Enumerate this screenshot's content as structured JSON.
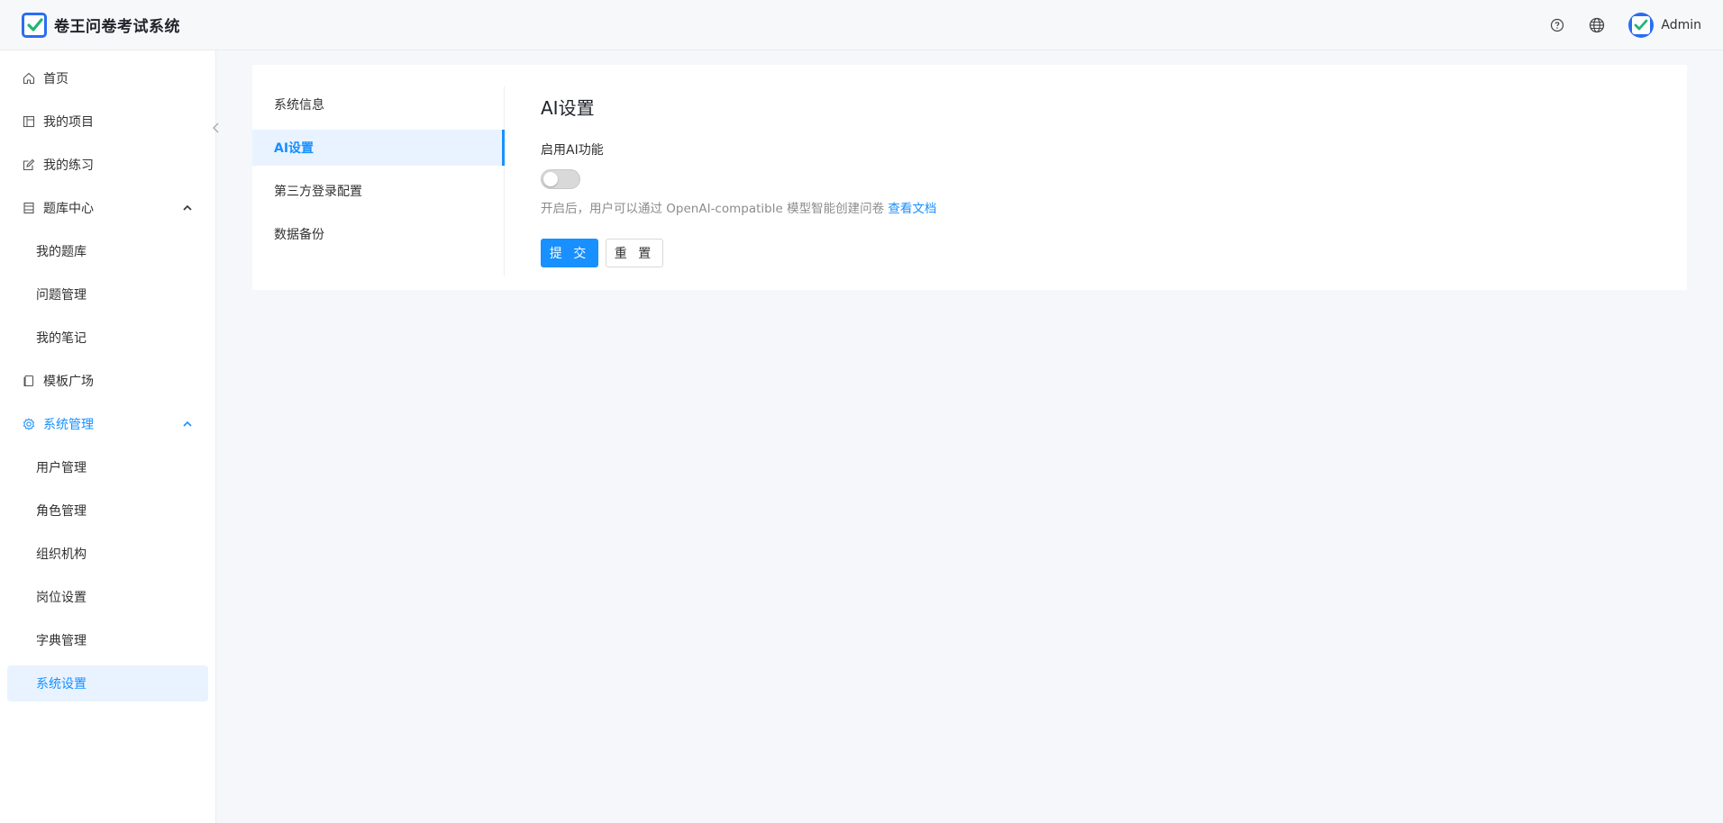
{
  "header": {
    "app_title": "卷王问卷考试系统",
    "user_name": "Admin",
    "icons": [
      "help-icon",
      "globe-icon",
      "avatar"
    ]
  },
  "sidebar": {
    "items": [
      {
        "label": "首页",
        "icon": "home-icon"
      },
      {
        "label": "我的项目",
        "icon": "project-icon"
      },
      {
        "label": "我的练习",
        "icon": "edit-icon"
      },
      {
        "label": "题库中心",
        "icon": "database-icon",
        "expanded": true
      },
      {
        "label": "我的题库"
      },
      {
        "label": "问题管理"
      },
      {
        "label": "我的笔记"
      },
      {
        "label": "模板广场",
        "icon": "template-icon"
      },
      {
        "label": "系统管理",
        "icon": "gear-icon",
        "expanded": true,
        "active": true
      },
      {
        "label": "用户管理"
      },
      {
        "label": "角色管理"
      },
      {
        "label": "组织机构"
      },
      {
        "label": "岗位设置"
      },
      {
        "label": "字典管理"
      },
      {
        "label": "系统设置",
        "selected": true
      }
    ]
  },
  "settings_nav": {
    "items": [
      "系统信息",
      "AI设置",
      "第三方登录配置",
      "数据备份"
    ],
    "active_index": 1
  },
  "panel": {
    "title": "AI设置",
    "field_label": "启用AI功能",
    "switch_on": false,
    "hint_text": "开启后，用户可以通过 OpenAI-compatible 模型智能创建问卷 ",
    "hint_link": "查看文档",
    "submit_label": "提 交",
    "reset_label": "重 置"
  },
  "colors": {
    "accent": "#1890ff",
    "brand": "#2a6df4",
    "selected_bg": "#e8f3ff"
  }
}
